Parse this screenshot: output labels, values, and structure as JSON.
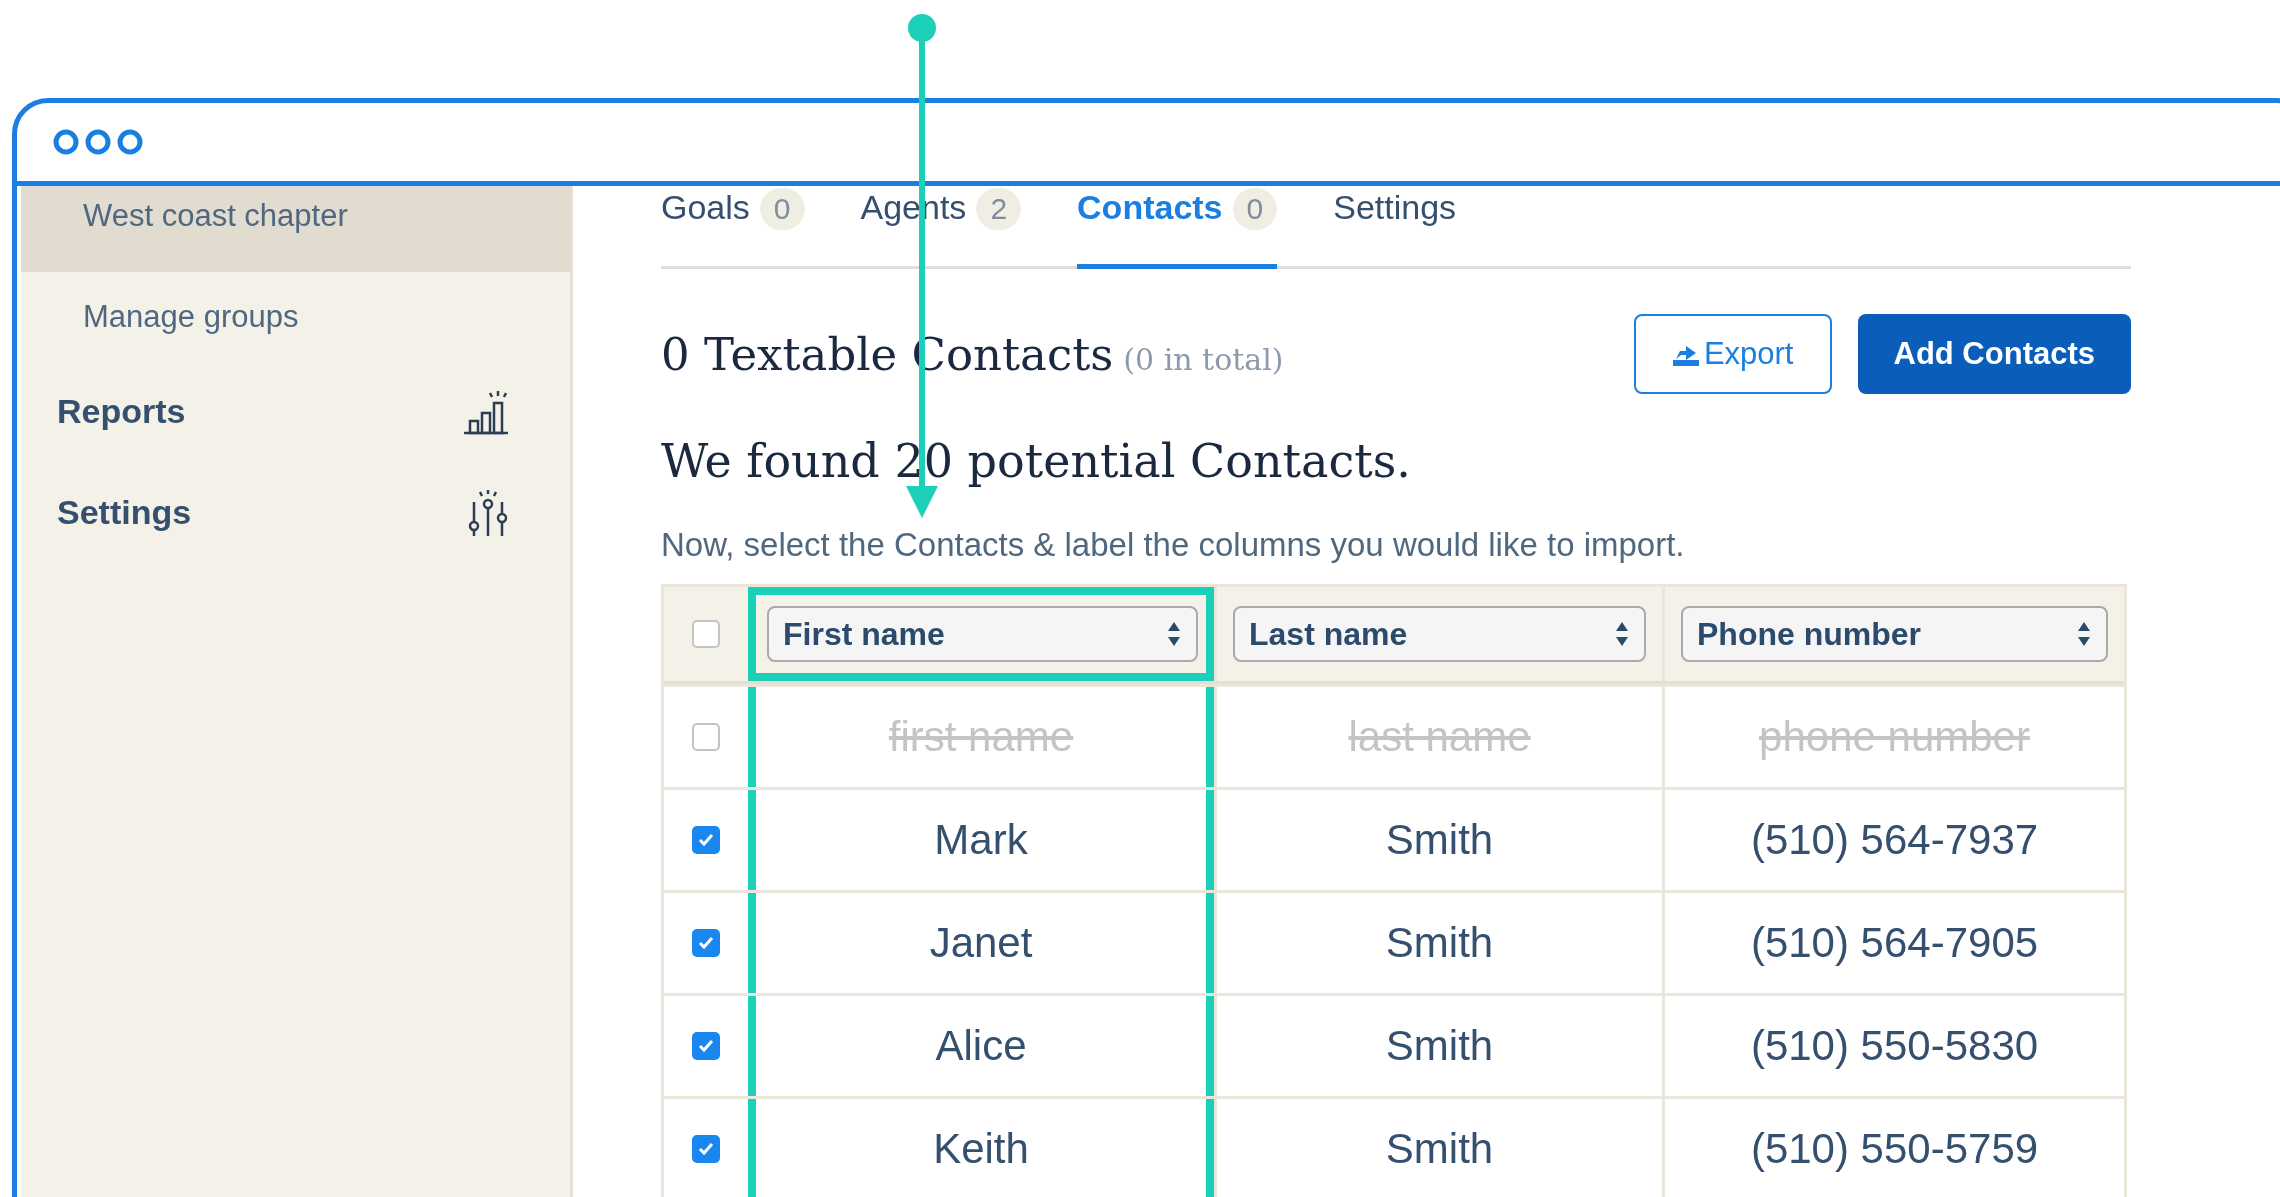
{
  "sidebar": {
    "items": [
      {
        "label": "West coast chapter",
        "kind": "sub",
        "selected": true
      },
      {
        "label": "Manage groups",
        "kind": "sub",
        "selected": false
      },
      {
        "label": "Reports",
        "kind": "section",
        "selected": false
      },
      {
        "label": "Settings",
        "kind": "section",
        "selected": false
      }
    ]
  },
  "tabs": [
    {
      "label": "Goals",
      "count": "0",
      "selected": false
    },
    {
      "label": "Agents",
      "count": "2",
      "selected": false
    },
    {
      "label": "Contacts",
      "count": "0",
      "selected": true
    },
    {
      "label": "Settings",
      "selected": false
    }
  ],
  "summary": {
    "title": "0 Textable Contacts",
    "total": "(0 in total)"
  },
  "buttons": [
    {
      "label": "Export",
      "kind": "outline"
    },
    {
      "label": "Add Contacts",
      "kind": "primary"
    }
  ],
  "found_heading": "We found 20 potential Contacts.",
  "instruction": "Now, select the Contacts & label the columns you would like to import.",
  "table": {
    "select_all": {
      "checked": false
    },
    "columns": [
      {
        "label": "First name",
        "highlighted": true
      },
      {
        "label": "Last name",
        "highlighted": false
      },
      {
        "label": "Phone number",
        "highlighted": false
      }
    ],
    "rows": [
      {
        "checked": false,
        "excluded": true,
        "cells": [
          "first name",
          "last name",
          "phone number"
        ]
      },
      {
        "checked": true,
        "excluded": false,
        "cells": [
          "Mark",
          "Smith",
          "(510) 564-7937"
        ]
      },
      {
        "checked": true,
        "excluded": false,
        "cells": [
          "Janet",
          "Smith",
          "(510) 564-7905"
        ]
      },
      {
        "checked": true,
        "excluded": false,
        "cells": [
          "Alice",
          "Smith",
          "(510) 550-5830"
        ]
      },
      {
        "checked": true,
        "excluded": false,
        "cells": [
          "Keith",
          "Smith",
          "(510) 550-5759"
        ]
      }
    ]
  }
}
